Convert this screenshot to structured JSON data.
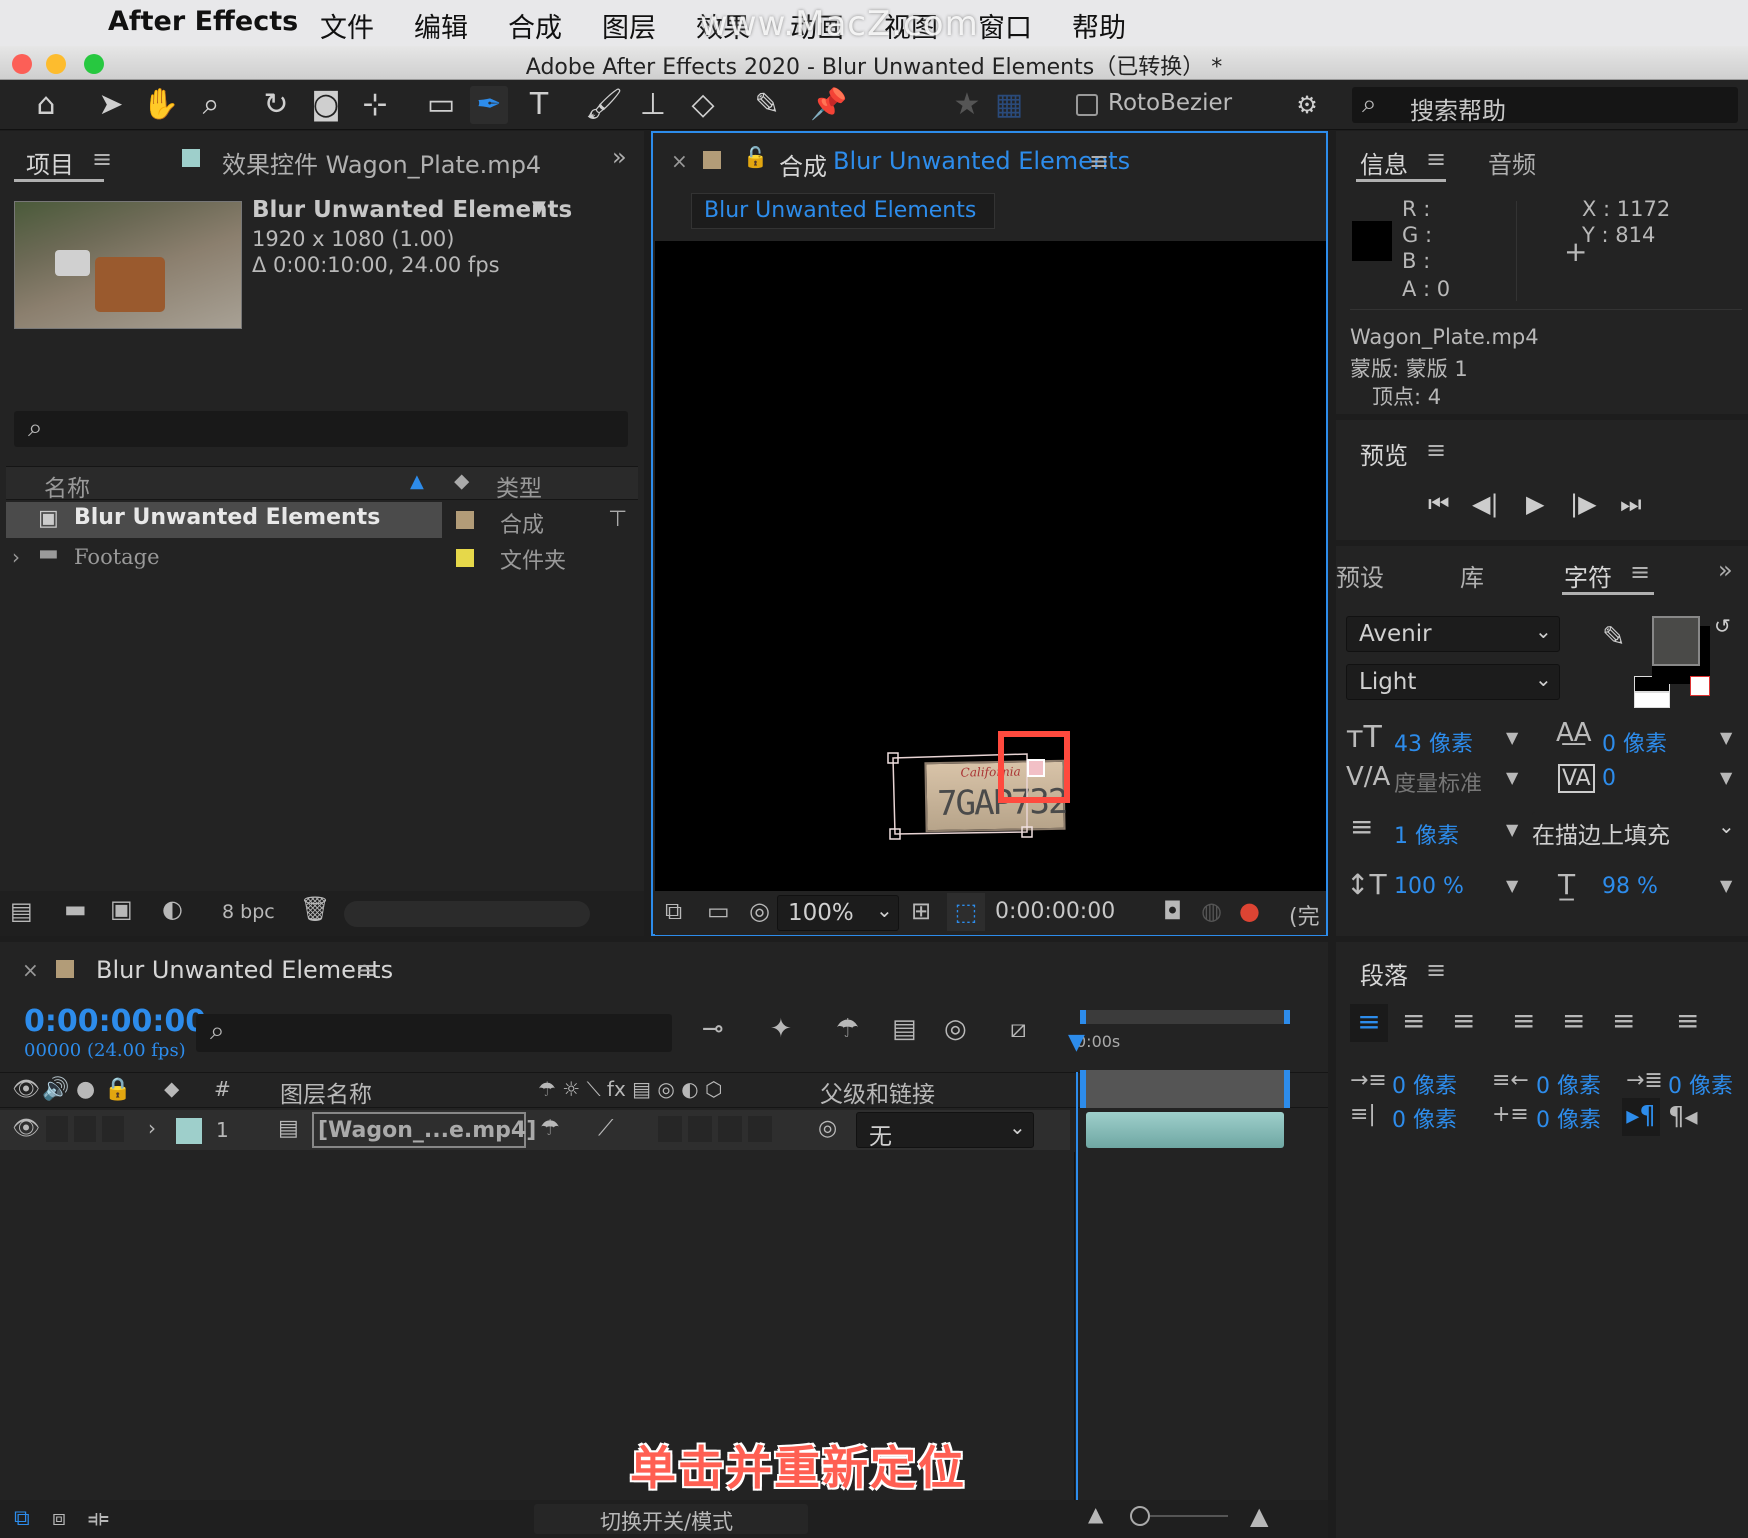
{
  "menubar": {
    "apple": "",
    "app": "After Effects",
    "items": [
      "文件",
      "编辑",
      "合成",
      "图层",
      "效果",
      "动画",
      "视图",
      "窗口",
      "帮助"
    ],
    "watermark": "www.MacZ.com"
  },
  "window": {
    "title": "Adobe After Effects 2020 - Blur Unwanted Elements（已转换） *"
  },
  "toolbar": {
    "tools": [
      "home-icon",
      "selection-icon",
      "hand-icon",
      "zoom-icon",
      "rotate-icon",
      "camera-icon",
      "pan-behind-icon",
      "rectangle-icon",
      "pen-icon",
      "text-icon",
      "brush-icon",
      "clone-stamp-icon",
      "eraser-icon",
      "roto-brush-icon",
      "puppet-pin-icon"
    ],
    "rotobezier": "RotoBezier",
    "help_search": "搜索帮助"
  },
  "project": {
    "tab_project": "项目",
    "tab_effects": "效果控件 Wagon_Plate.mp4",
    "item_name": "Blur Unwanted Elements",
    "item_res": "1920 x 1080 (1.00)",
    "item_dur": "Δ 0:00:10:00, 24.00 fps",
    "col_name": "名称",
    "col_type": "类型",
    "rows": [
      {
        "name": "Blur Unwanted Elements",
        "type": "合成",
        "color": "#b29c78"
      },
      {
        "name": "Footage",
        "type": "文件夹",
        "color": "#e6d84a"
      }
    ],
    "bpc": "8 bpc"
  },
  "comp": {
    "tab_prefix": "合成",
    "tab_name": "Blur Unwanted Elements",
    "subtab": "Blur Unwanted Elements",
    "plate_text": "7GAP732",
    "plate_state": "California",
    "zoom": "100%",
    "timecode": "0:00:00:00",
    "quality": "(完"
  },
  "info": {
    "tab_info": "信息",
    "tab_audio": "音频",
    "r": "R :",
    "g": "G :",
    "b": "B :",
    "a": "A :  0",
    "x": "X : 1172",
    "y": "Y :  814",
    "file": "Wagon_Plate.mp4",
    "mask": "蒙版: 蒙版 1",
    "vertices": "顶点: 4"
  },
  "preview": {
    "title": "预览"
  },
  "character": {
    "tab_presets": "预设",
    "tab_library": "库",
    "tab_char": "字符",
    "font": "Avenir",
    "style": "Light",
    "size": "43 像素",
    "leading": "0 像素",
    "kerning": "度量标准",
    "tracking": "0",
    "stroke_width": "1 像素",
    "stroke_mode": "在描边上填充",
    "vscale": "100 %",
    "hscale": "98 %",
    "fill_color": "#4a4a48"
  },
  "paragraph": {
    "title": "段落",
    "indent_left": "0 像素",
    "indent_right": "0 像素",
    "indent_first": "0 像素",
    "space_before": "0 像素",
    "space_after": "0 像素"
  },
  "timeline": {
    "comp_name": "Blur Unwanted Elements",
    "timecode": "0:00:00:00",
    "fps": "00000 (24.00 fps)",
    "col_num": "#",
    "col_layer": "图层名称",
    "col_parent": "父级和链接",
    "layer_num": "1",
    "layer_name": "[Wagon_...e.mp4]",
    "parent": "无",
    "ruler": "0:00s",
    "footer_toggle": "切换开关/模式"
  },
  "caption": "单击并重新定位"
}
